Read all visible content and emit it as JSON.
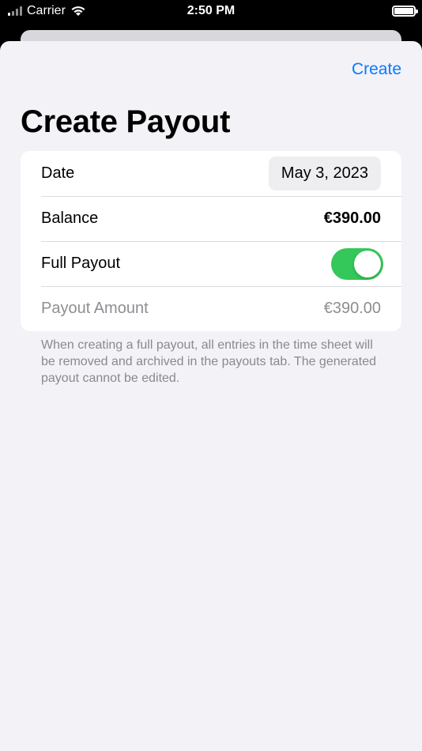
{
  "status_bar": {
    "carrier": "Carrier",
    "time": "2:50 PM"
  },
  "nav": {
    "create_label": "Create"
  },
  "page": {
    "title": "Create Payout"
  },
  "form": {
    "date_label": "Date",
    "date_value": "May 3, 2023",
    "balance_label": "Balance",
    "balance_value": "€390.00",
    "full_payout_label": "Full Payout",
    "full_payout_on": true,
    "payout_amount_label": "Payout Amount",
    "payout_amount_value": "€390.00"
  },
  "footer_note": "When creating a full payout, all entries in the time sheet will be removed and archived in the payouts tab. The generated payout cannot be edited.",
  "colors": {
    "accent": "#0a7aff",
    "toggle_on": "#34c759",
    "background": "#f2f2f7"
  }
}
